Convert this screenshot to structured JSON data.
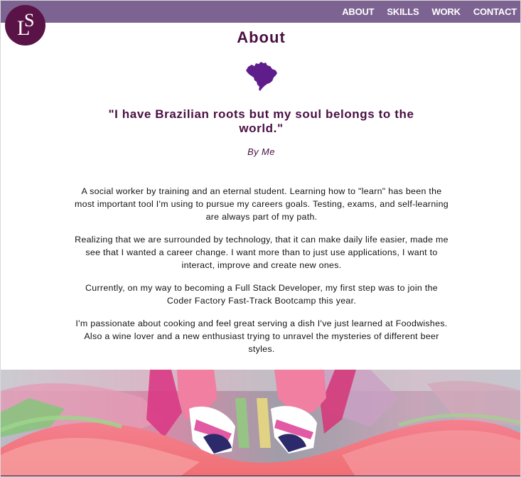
{
  "logo": {
    "text_l": "L",
    "text_s": "S",
    "background": "#5a1346"
  },
  "nav": {
    "items": [
      {
        "label": "ABOUT"
      },
      {
        "label": "SKILLS"
      },
      {
        "label": "WORK"
      },
      {
        "label": "CONTACT"
      }
    ]
  },
  "about": {
    "title": "About",
    "map_icon": "brazil-map-icon",
    "quote": "\"I have Brazilian roots but my soul belongs to the world.\"",
    "author": "By Me",
    "paragraphs": [
      "A social worker by training and an eternal student. Learning how to \"learn\" has been the most important tool I'm using to pursue my careers goals. Testing, exams, and self-learning are always part of my path.",
      "Realizing that we are surrounded by technology, that it can make daily life easier, made me see that I wanted a career change. I want more than to just use applications, I want to interact, improve and create new ones.",
      "Currently, on my way to becoming a Full Stack Developer, my first step was to join the Coder Factory Fast-Track Bootcamp this year.",
      "I'm passionate about cooking and feel great serving a dish I've just learned at Foodwishes. Also a wine lover and a new enthusiast trying to unravel the mysteries of different beer styles."
    ]
  },
  "colors": {
    "navbar": "#7d6392",
    "accent": "#4a0f43",
    "map": "#5f1d8c"
  }
}
